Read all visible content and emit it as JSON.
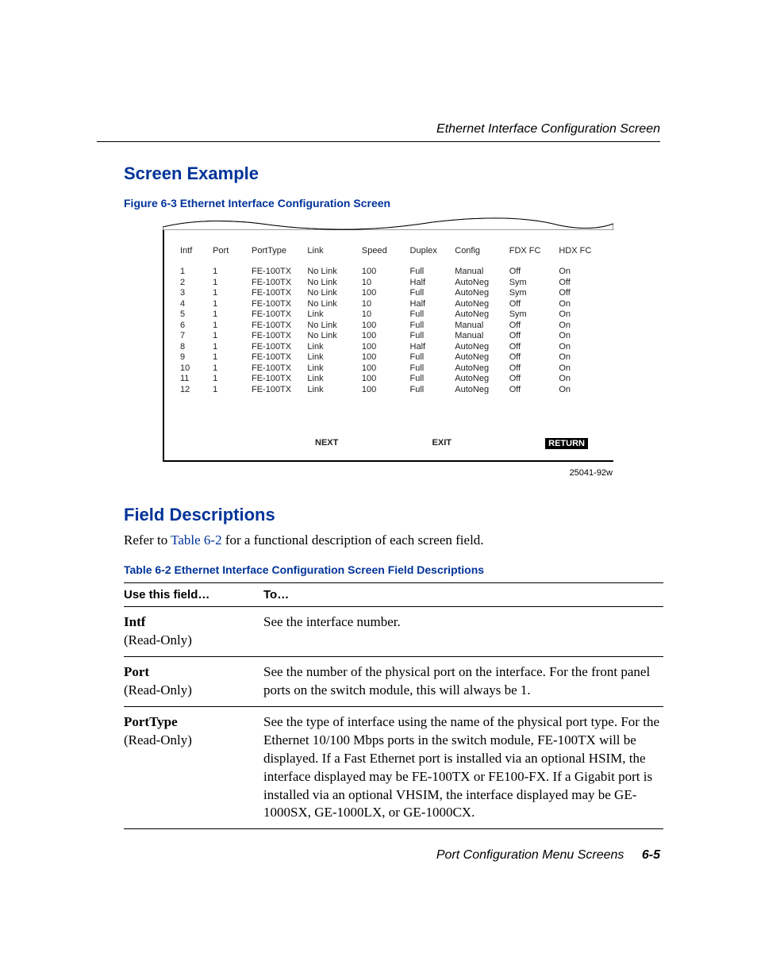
{
  "header": {
    "running": "Ethernet Interface Configuration Screen"
  },
  "section1": {
    "title": "Screen Example",
    "figCaption": "Figure 6-3   Ethernet Interface Configuration Screen"
  },
  "terminal": {
    "cols": [
      "Intf",
      "Port",
      "PortType",
      "Link",
      "Speed",
      "Duplex",
      "Config",
      "FDX FC",
      "HDX FC"
    ],
    "rows": [
      {
        "intf": "1",
        "port": "1",
        "ptype": "FE-100TX",
        "link": "No Link",
        "speed": "100",
        "duplex": "Full",
        "config": "Manual",
        "fdx": "Off",
        "hdx": "On"
      },
      {
        "intf": "2",
        "port": "1",
        "ptype": "FE-100TX",
        "link": "No Link",
        "speed": "10",
        "duplex": "Half",
        "config": "AutoNeg",
        "fdx": "Sym",
        "hdx": "Off"
      },
      {
        "intf": "3",
        "port": "1",
        "ptype": "FE-100TX",
        "link": "No Link",
        "speed": "100",
        "duplex": "Full",
        "config": "AutoNeg",
        "fdx": "Sym",
        "hdx": "Off"
      },
      {
        "intf": "4",
        "port": "1",
        "ptype": "FE-100TX",
        "link": "No Link",
        "speed": "10",
        "duplex": "Half",
        "config": "AutoNeg",
        "fdx": "Off",
        "hdx": "On"
      },
      {
        "intf": "5",
        "port": "1",
        "ptype": "FE-100TX",
        "link": "Link",
        "speed": "10",
        "duplex": "Full",
        "config": "AutoNeg",
        "fdx": "Sym",
        "hdx": "On"
      },
      {
        "intf": "6",
        "port": "1",
        "ptype": "FE-100TX",
        "link": "No Link",
        "speed": "100",
        "duplex": "Full",
        "config": "Manual",
        "fdx": "Off",
        "hdx": "On"
      },
      {
        "intf": "7",
        "port": "1",
        "ptype": "FE-100TX",
        "link": "No Link",
        "speed": "100",
        "duplex": "Full",
        "config": "Manual",
        "fdx": "Off",
        "hdx": "On"
      },
      {
        "intf": "8",
        "port": "1",
        "ptype": "FE-100TX",
        "link": "Link",
        "speed": "100",
        "duplex": "Half",
        "config": "AutoNeg",
        "fdx": "Off",
        "hdx": "On"
      },
      {
        "intf": "9",
        "port": "1",
        "ptype": "FE-100TX",
        "link": "Link",
        "speed": "100",
        "duplex": "Full",
        "config": "AutoNeg",
        "fdx": "Off",
        "hdx": "On"
      },
      {
        "intf": "10",
        "port": "1",
        "ptype": "FE-100TX",
        "link": "Link",
        "speed": "100",
        "duplex": "Full",
        "config": "AutoNeg",
        "fdx": "Off",
        "hdx": "On"
      },
      {
        "intf": "11",
        "port": "1",
        "ptype": "FE-100TX",
        "link": "Link",
        "speed": "100",
        "duplex": "Full",
        "config": "AutoNeg",
        "fdx": "Off",
        "hdx": "On"
      },
      {
        "intf": "12",
        "port": "1",
        "ptype": "FE-100TX",
        "link": "Link",
        "speed": "100",
        "duplex": "Full",
        "config": "AutoNeg",
        "fdx": "Off",
        "hdx": "On"
      }
    ],
    "btnNext": "NEXT",
    "btnExit": "EXIT",
    "btnReturn": "RETURN",
    "figureId": "25041-92w"
  },
  "section2": {
    "title": "Field Descriptions",
    "para_pre": "Refer to ",
    "para_link": "Table 6-2",
    "para_post": " for a functional description of each screen field.",
    "tableCaption": "Table 6-2   Ethernet Interface Configuration Screen Field Descriptions"
  },
  "table62": {
    "h1": "Use this field…",
    "h2": "To…",
    "rows": [
      {
        "name": "Intf",
        "ro": "(Read-Only)",
        "desc": "See the interface number."
      },
      {
        "name": "Port",
        "ro": "(Read-Only)",
        "desc": "See the number of the physical port on the interface. For the front panel ports on the switch module, this will always be 1."
      },
      {
        "name": "PortType",
        "ro": "(Read-Only)",
        "desc": "See the type of interface using the name of the physical port type. For the Ethernet 10/100 Mbps ports in the switch module, FE-100TX will be displayed. If a Fast Ethernet port is installed via an optional HSIM, the interface displayed may be FE-100TX or FE100-FX. If a Gigabit port is installed via an optional VHSIM, the interface displayed may be GE-1000SX, GE-1000LX, or GE-1000CX."
      }
    ]
  },
  "footer": {
    "text": "Port Configuration Menu Screens",
    "page": "6-5"
  }
}
